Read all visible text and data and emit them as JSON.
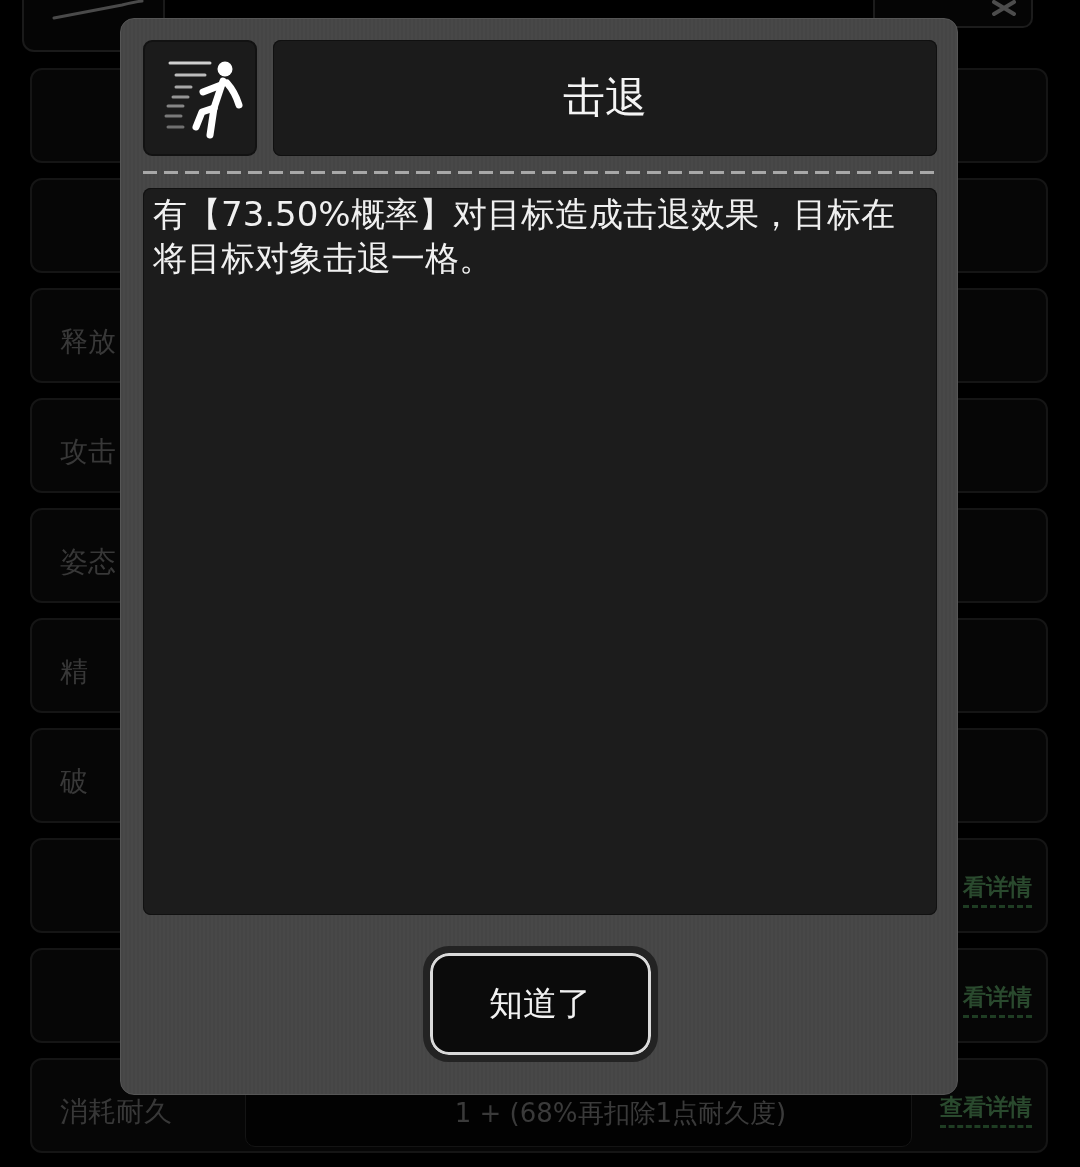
{
  "rows": [
    {},
    {},
    {
      "label": "释放"
    },
    {
      "label": "攻击"
    },
    {
      "label": "姿态"
    },
    {
      "label": "精"
    },
    {
      "label": "破"
    },
    {
      "link": "看详情"
    },
    {
      "link": "看详情"
    },
    {
      "label": "消耗耐久",
      "value": "1 + (68%再扣除1点耐久度)",
      "link": "查看详情"
    }
  ],
  "dialog": {
    "title": "击退",
    "description": "有【73.50%概率】对目标造成击退效果，目标在将目标对象击退一格。",
    "button": "知道了"
  }
}
